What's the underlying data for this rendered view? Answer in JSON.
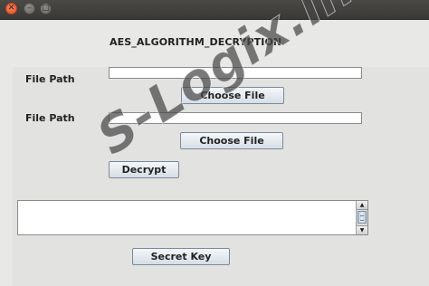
{
  "window": {
    "title": "",
    "controls": [
      "close-icon",
      "minimize-icon",
      "maximize-icon"
    ]
  },
  "app_title": "AES_ALGORITHM_DECRYPTION",
  "form": {
    "file_path_label_1": "File Path",
    "file_path_value_1": "",
    "choose_file_label_1": "Choose File",
    "file_path_label_2": "File Path",
    "file_path_value_2": "",
    "choose_file_label_2": "Choose File",
    "decrypt_label": "Decrypt",
    "output_text": "",
    "secret_key_label": "Secret Key"
  },
  "watermark": "S-Logix.in",
  "colors": {
    "close_button": "#e0512b",
    "titlebar": "#3f3e3a",
    "background": "#e8e8e7",
    "button_border": "#7b8a99"
  }
}
